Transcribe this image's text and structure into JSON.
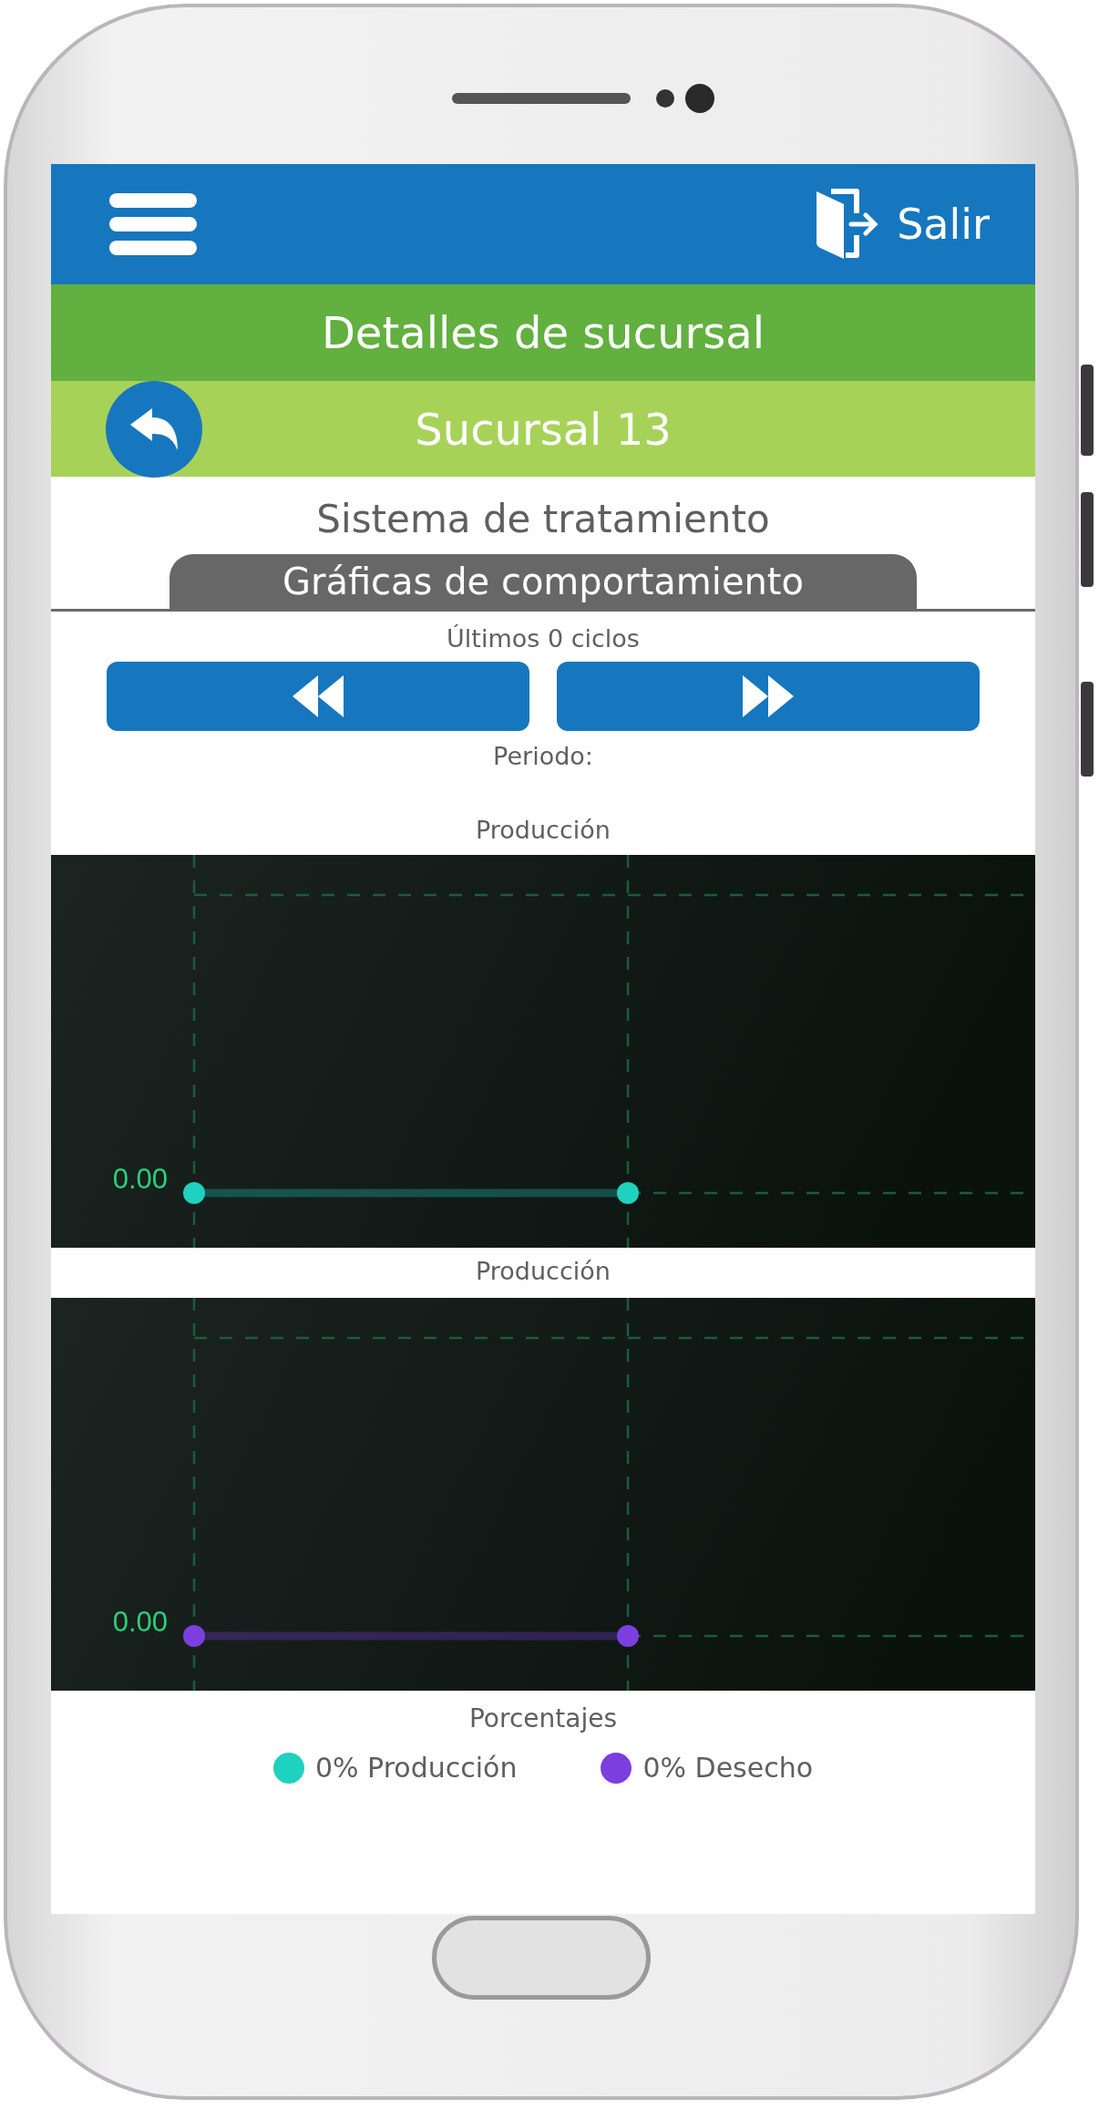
{
  "header": {
    "exit_label": "Salir"
  },
  "title": "Detalles de sucursal",
  "branch": {
    "name": "Sucursal 13"
  },
  "system": "Sistema de tratamiento",
  "tab": {
    "label": "Gráficas de comportamiento",
    "selected": true
  },
  "cycles_label": "Últimos 0 ciclos",
  "period_label": "Periodo:",
  "charts": [
    {
      "title": "Producción",
      "axis_label": "0.00",
      "color": "#1fd1bf"
    },
    {
      "title": "Producción",
      "axis_label": "0.00",
      "color": "#7b3fe0"
    }
  ],
  "percentages": {
    "title": "Porcentajes",
    "legend": [
      {
        "label": "0% Producción",
        "color": "#1fd1bf"
      },
      {
        "label": "0% Desecho",
        "color": "#7b3fe0"
      }
    ]
  }
}
